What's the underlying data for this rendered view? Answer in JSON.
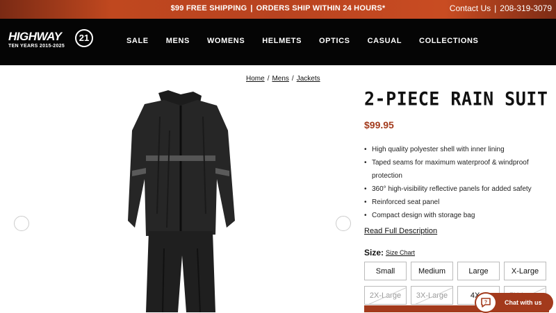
{
  "topbar": {
    "promo_left": "$99 FREE SHIPPING",
    "promo_sep": "|",
    "promo_right": "ORDERS SHIP WITHIN 24 HOURS*",
    "contact_label": "Contact Us",
    "contact_sep": "|",
    "phone": "208-319-3079"
  },
  "logo": {
    "word": "HIGHWAY",
    "badge": "21",
    "tagline": "TEN YEARS 2015-2025"
  },
  "nav": {
    "items": [
      {
        "label": "SALE"
      },
      {
        "label": "MENS"
      },
      {
        "label": "WOMENS"
      },
      {
        "label": "HELMETS"
      },
      {
        "label": "OPTICS"
      },
      {
        "label": "CASUAL"
      },
      {
        "label": "COLLECTIONS"
      }
    ]
  },
  "breadcrumb": {
    "items": [
      "Home",
      "Mens",
      "Jackets"
    ],
    "sep": "/"
  },
  "product": {
    "title": "2-PIECE RAIN SUIT",
    "price": "$99.95",
    "features": [
      "High quality polyester shell with inner lining",
      "Taped seams for maximum waterproof & windproof protection",
      "360° high-visibility reflective panels for added safety",
      "Reinforced seat panel",
      "Compact design with storage bag"
    ],
    "read_more": "Read Full Description",
    "size_label": "Size:",
    "size_chart": "Size Chart",
    "sizes": [
      {
        "label": "Small",
        "available": true
      },
      {
        "label": "Medium",
        "available": true
      },
      {
        "label": "Large",
        "available": true
      },
      {
        "label": "X-Large",
        "available": true
      },
      {
        "label": "2X-Large",
        "available": false
      },
      {
        "label": "3X-Large",
        "available": false
      },
      {
        "label": "4X-L",
        "available": true
      },
      {
        "label": "5X-Large",
        "available": false
      }
    ]
  },
  "chat": {
    "label": "Chat with us"
  },
  "colors": {
    "accent": "#a33a1c",
    "topbar": "#b5401f",
    "nav_bg": "#050505"
  }
}
